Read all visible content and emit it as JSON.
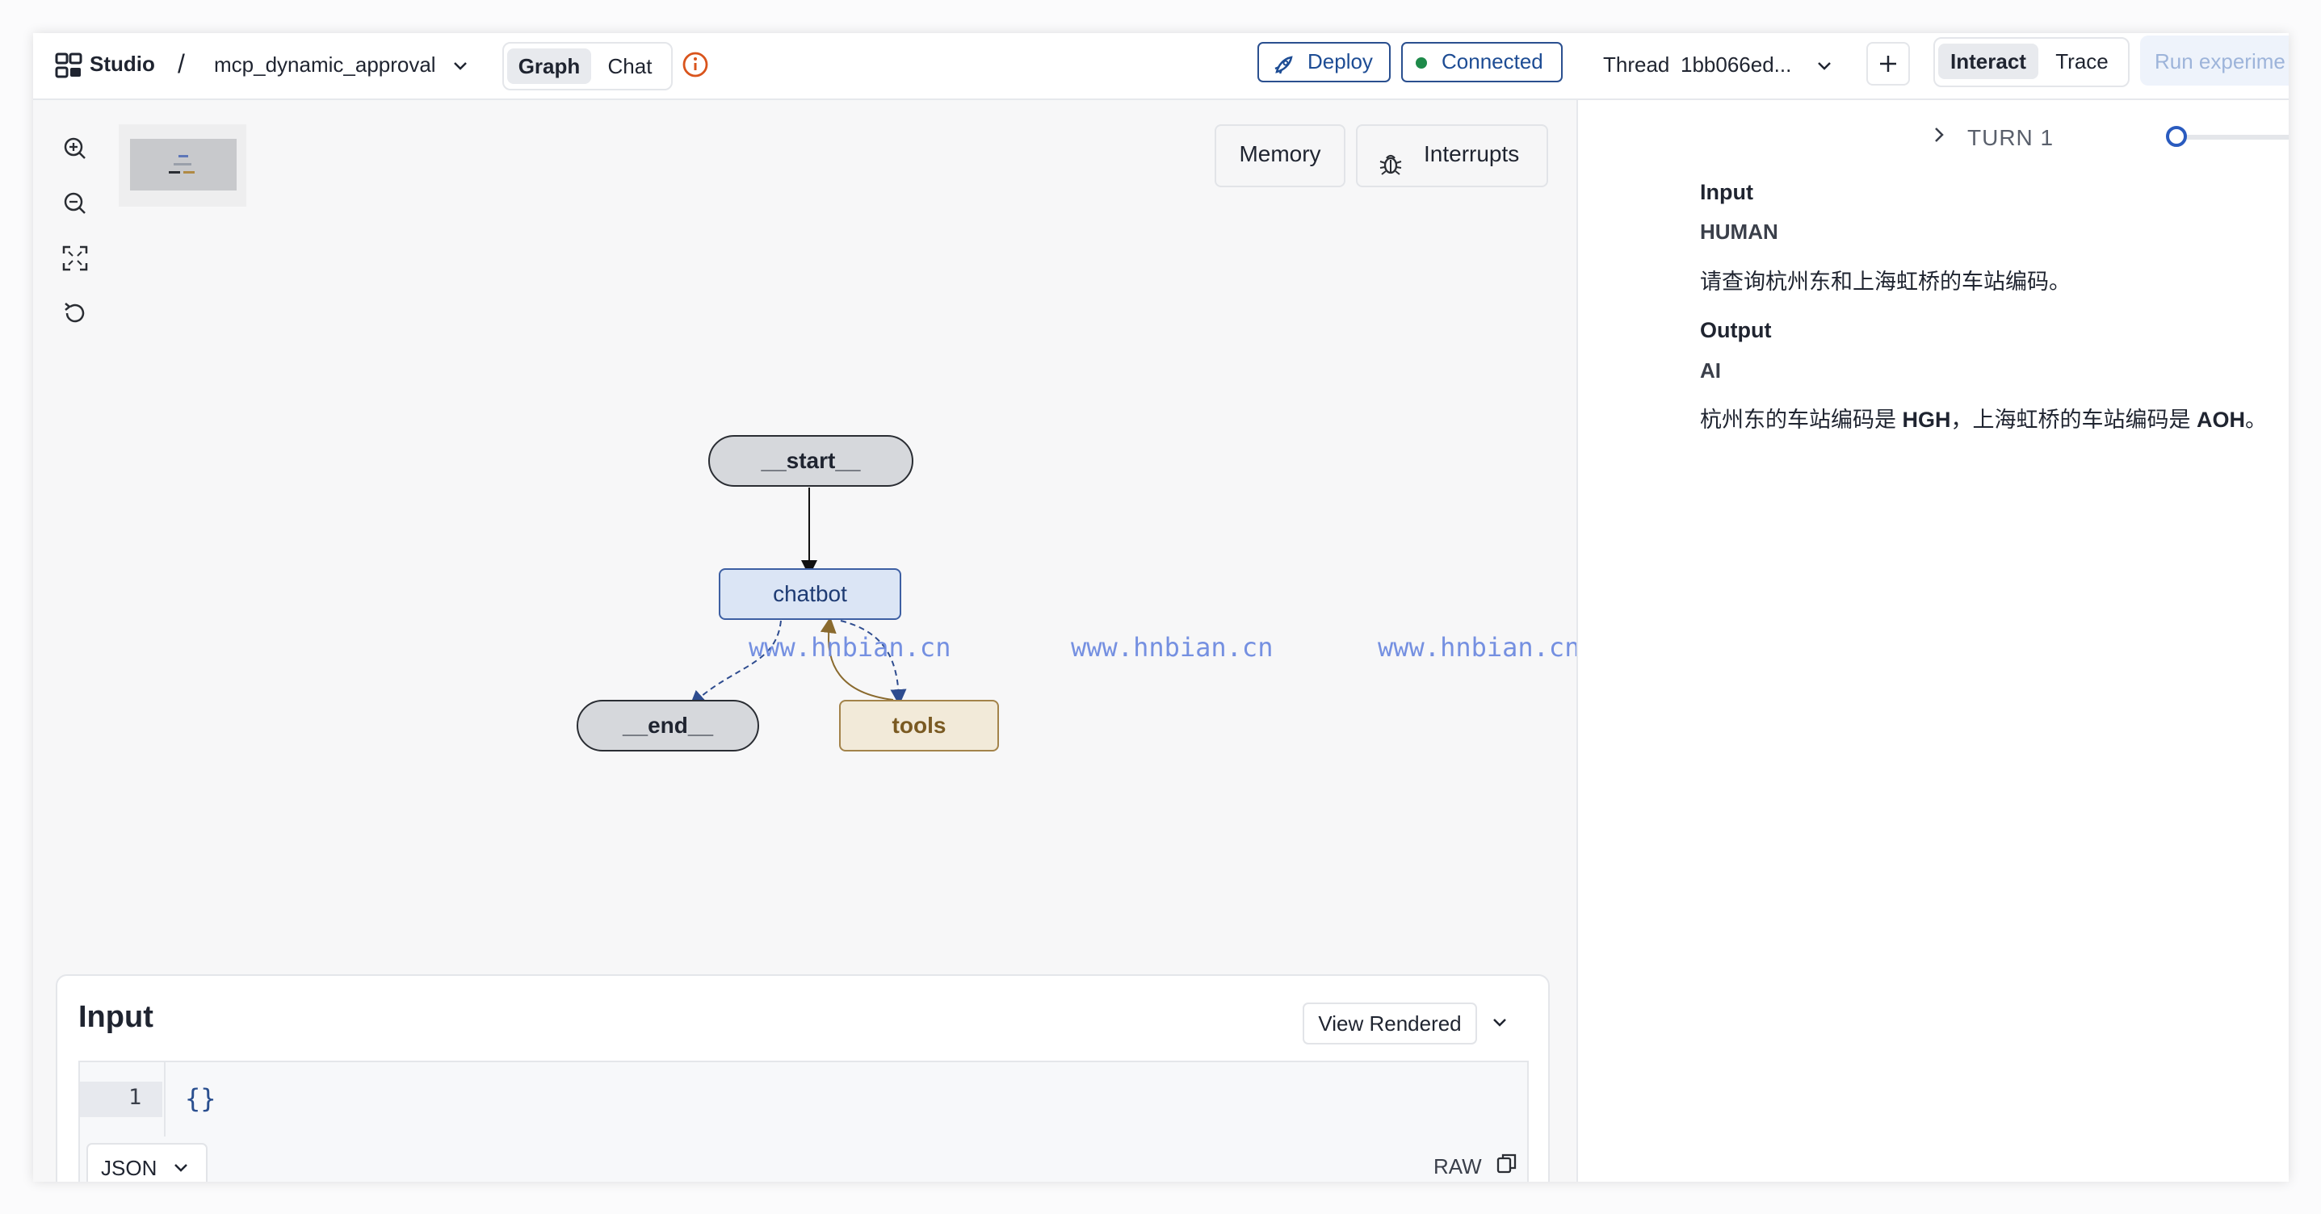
{
  "header": {
    "studio_label": "Studio",
    "separator": "/",
    "project_name": "mcp_dynamic_approval",
    "view_tabs": [
      {
        "label": "Graph",
        "active": true
      },
      {
        "label": "Chat",
        "active": false
      }
    ],
    "deploy_label": "Deploy",
    "status_label": "Connected",
    "status_color": "#1e8a4a",
    "thread_label": "Thread",
    "thread_id": "1bb066ed...",
    "mode_tabs": [
      {
        "label": "Interact",
        "active": true
      },
      {
        "label": "Trace",
        "active": false
      }
    ],
    "run_experiment_label": "Run experime"
  },
  "graph": {
    "toolbar_icons": [
      "zoom-in-icon",
      "zoom-out-icon",
      "fit-view-icon",
      "reset-icon"
    ],
    "memory_label": "Memory",
    "interrupts_label": "Interrupts",
    "nodes": {
      "start": "__start__",
      "chatbot": "chatbot",
      "end": "__end__",
      "tools": "tools"
    },
    "watermark": "www.hnbian.cn"
  },
  "input_panel": {
    "title": "Input",
    "view_mode": "View Rendered",
    "line_number": "1",
    "code": "{}",
    "format": "JSON",
    "raw_label": "RAW"
  },
  "trace": {
    "turn_label": "TURN 1",
    "input_heading": "Input",
    "input_role": "HUMAN",
    "input_message": "请查询杭州东和上海虹桥的车站编码。",
    "output_heading": "Output",
    "output_role": "AI",
    "output_message": {
      "part1": "杭州东的车站编码是 ",
      "code1": "HGH",
      "part2": "，上海虹桥的车站编码是 ",
      "code2": "AOH",
      "part3": "。"
    }
  },
  "colors": {
    "accent_blue": "#1d4c94",
    "node_blue": "#dbe5f5",
    "node_tan": "#f2ead9",
    "node_grey": "#d6d8dc"
  }
}
